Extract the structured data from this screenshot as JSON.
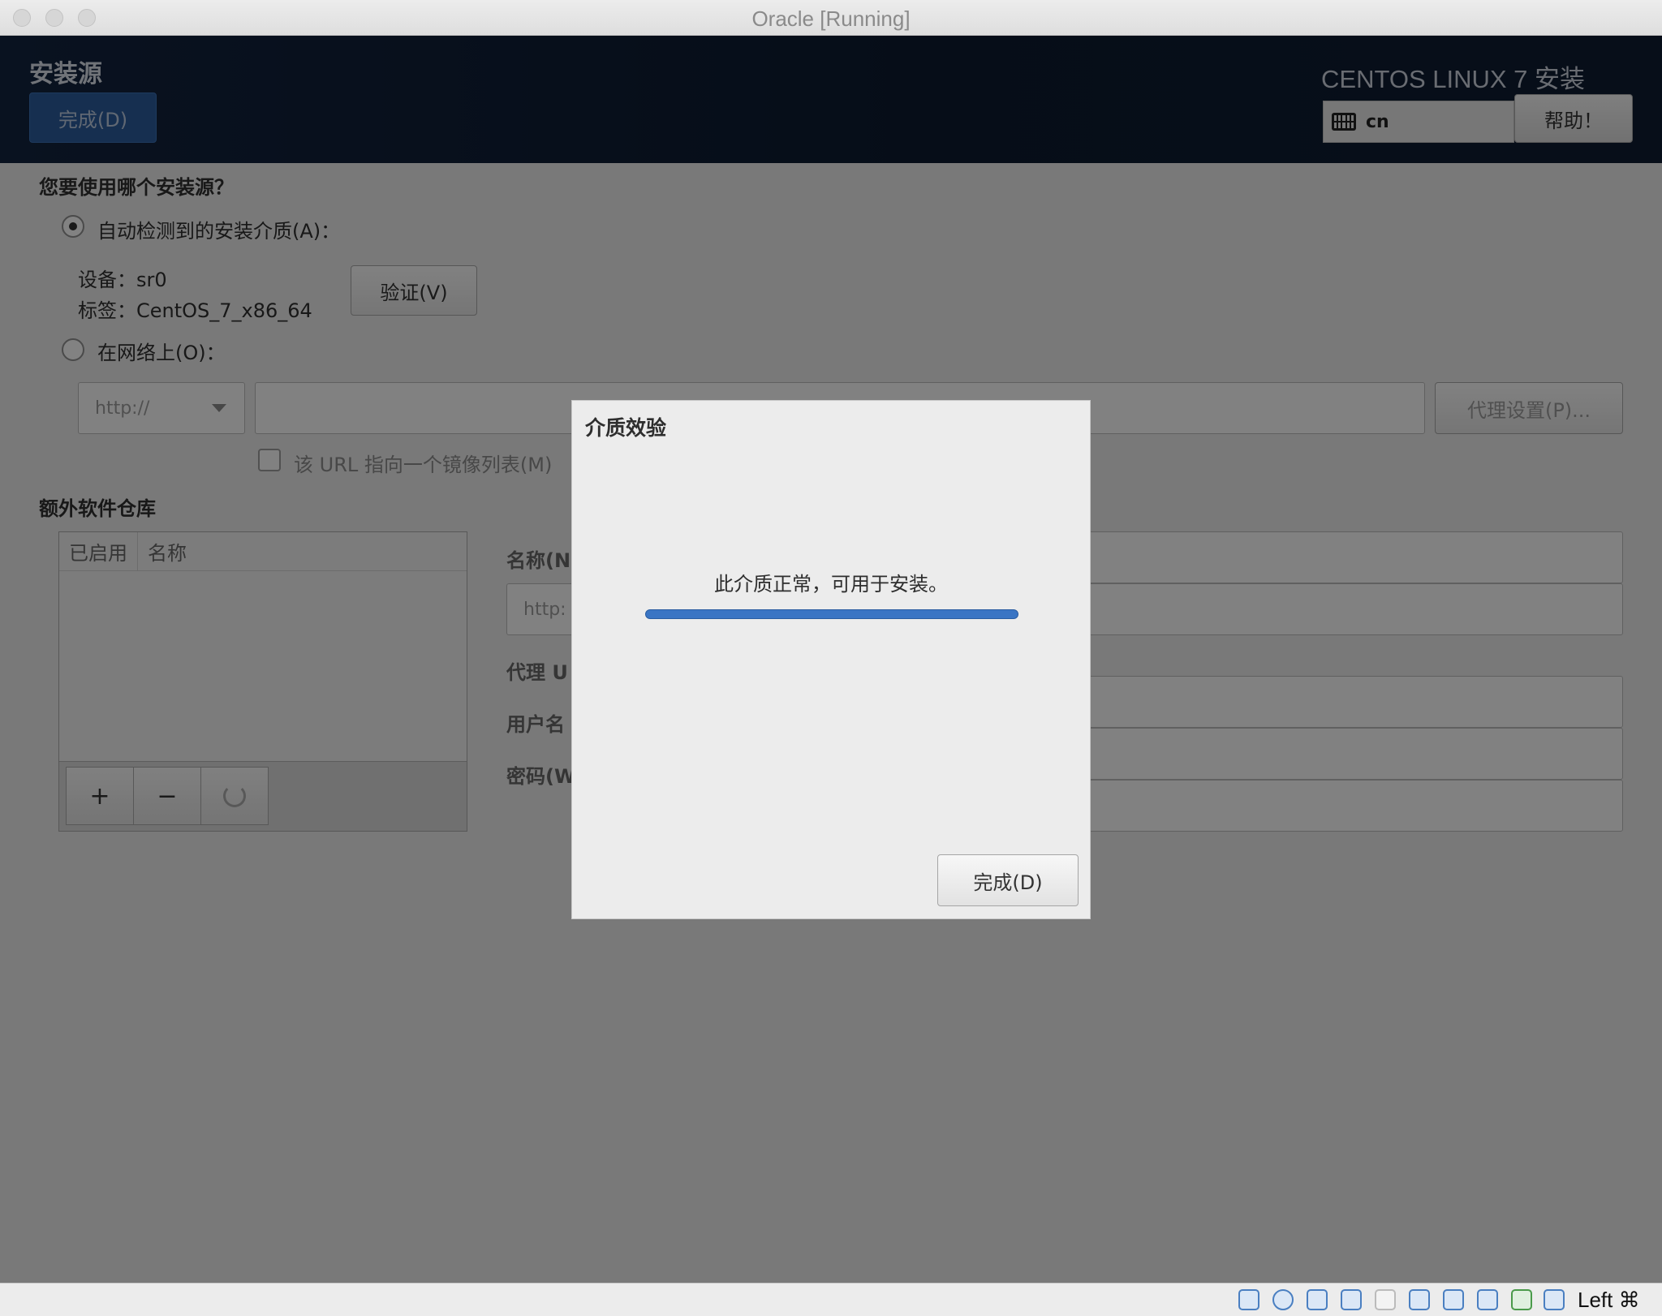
{
  "window": {
    "title": "Oracle [Running]"
  },
  "header": {
    "title": "安装源",
    "done_label": "完成(D)",
    "product": "CENTOS LINUX 7 安装",
    "keyboard_layout": "cn",
    "help_label": "帮助！"
  },
  "source": {
    "question": "您要使用哪个安装源？",
    "auto_label": "自动检测到的安装介质(A)：",
    "auto_selected": true,
    "device": "设备：sr0",
    "label": "标签：CentOS_7_x86_64",
    "verify_label": "验证(V)",
    "network_label": "在网络上(O)：",
    "protocol": "http://",
    "url_value": "",
    "proxy_label": "代理设置(P)...",
    "mirror_label": "该 URL 指向一个镜像列表(M)"
  },
  "repos": {
    "heading": "额外软件仓库",
    "columns": [
      "已启用",
      "名称"
    ],
    "add": "+",
    "remove": "−",
    "refresh_icon": "refresh-icon",
    "name_label": "名称(N",
    "url_placeholder": "http:",
    "proxy_url_label": "代理 U",
    "username_label": "用户名",
    "password_label": "密码(W"
  },
  "dialog": {
    "title": "介质效验",
    "message": "此介质正常，可用于安装。",
    "progress": 1.0,
    "done_label": "完成(D)"
  },
  "statusbar": {
    "host_key": "Left ⌘"
  }
}
